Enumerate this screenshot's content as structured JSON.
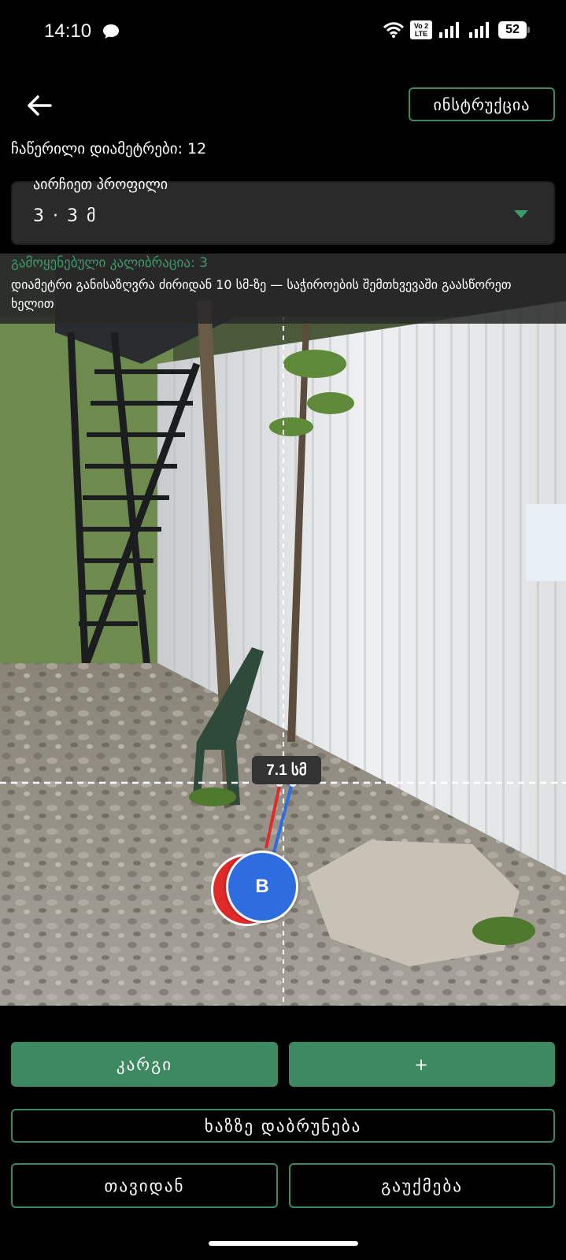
{
  "status_bar": {
    "time": "14:10",
    "volte_line1": "Vo 2",
    "volte_line2": "LTE",
    "battery": "52",
    "icons": [
      "chat-icon",
      "wifi-icon",
      "volte-icon",
      "signal-icon",
      "signal-icon",
      "battery-icon"
    ]
  },
  "header": {
    "back_icon": "arrow-left-icon",
    "instructions_label": "ინსტრუქცია",
    "recorded_text": "ჩაწერილი დიამეტრები: 12"
  },
  "profile": {
    "label": "აირჩიეთ პროფილი",
    "value": "3 · 3 მ",
    "icon": "dropdown-arrow-icon"
  },
  "camera": {
    "calibration_text": "გამოყენებული კალიბრაცია: 3",
    "note": "დიამეტრი განისაზღვრა ძირიდან 10 სმ-ზე — საჭიროების შემთხვევაში გაასწორეთ ხელით",
    "measurement": "7.1 სმ",
    "handle_b_label": "B",
    "handle_a_color": "#e02a2a",
    "handle_b_color": "#2d6de0"
  },
  "actions": {
    "ok": "კარგი",
    "add": "+",
    "back_to_line": "ხაზზე დაბრუნება",
    "restart": "თავიდან",
    "cancel": "გაუქმება"
  },
  "colors": {
    "accent": "#3d8a62",
    "background": "#000000"
  }
}
